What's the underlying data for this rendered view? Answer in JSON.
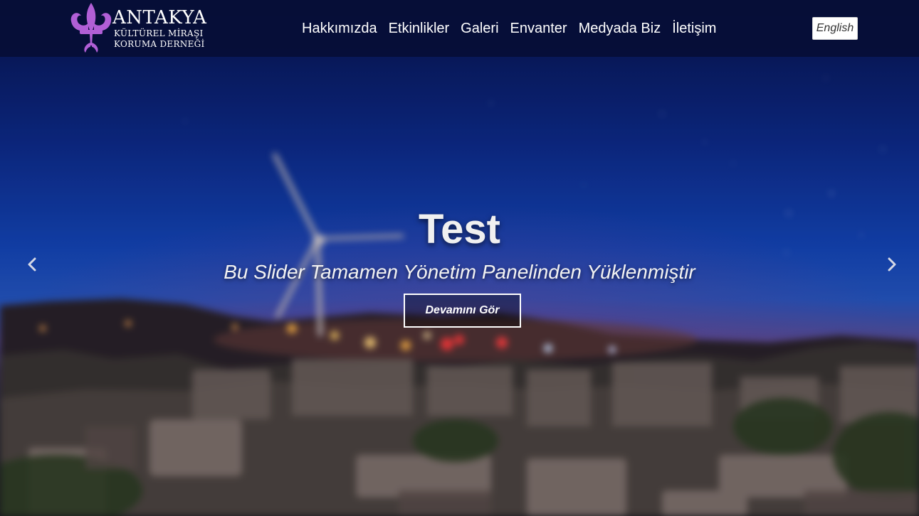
{
  "site": {
    "logo": {
      "title": "ANTAKYA",
      "subtitle_line1": "KÜLTÜREL MİRAŞI",
      "subtitle_line2": "KORUMA DERNEĞİ",
      "emblem_icon": "fleur-de-lis-icon",
      "emblem_color": "#b15fd6"
    },
    "nav": [
      {
        "label": "Hakkımızda"
      },
      {
        "label": "Etkinlikler"
      },
      {
        "label": "Galeri"
      },
      {
        "label": "Envanter"
      },
      {
        "label": "Medyada Biz"
      },
      {
        "label": "İletişim"
      }
    ],
    "language_button": "English"
  },
  "slider": {
    "title": "Test",
    "subtitle": "Bu Slider Tamamen Yönetim Panelinden Yüklenmiştir",
    "button_label": "Devamını Gör",
    "prev_icon": "chevron-left-icon",
    "next_icon": "chevron-right-icon",
    "background_description_colors": {
      "sky_top": "#08124a",
      "sky_mid": "#1446b8",
      "horizon": "#5a4f9a",
      "ground": "#1a1a1f"
    }
  }
}
